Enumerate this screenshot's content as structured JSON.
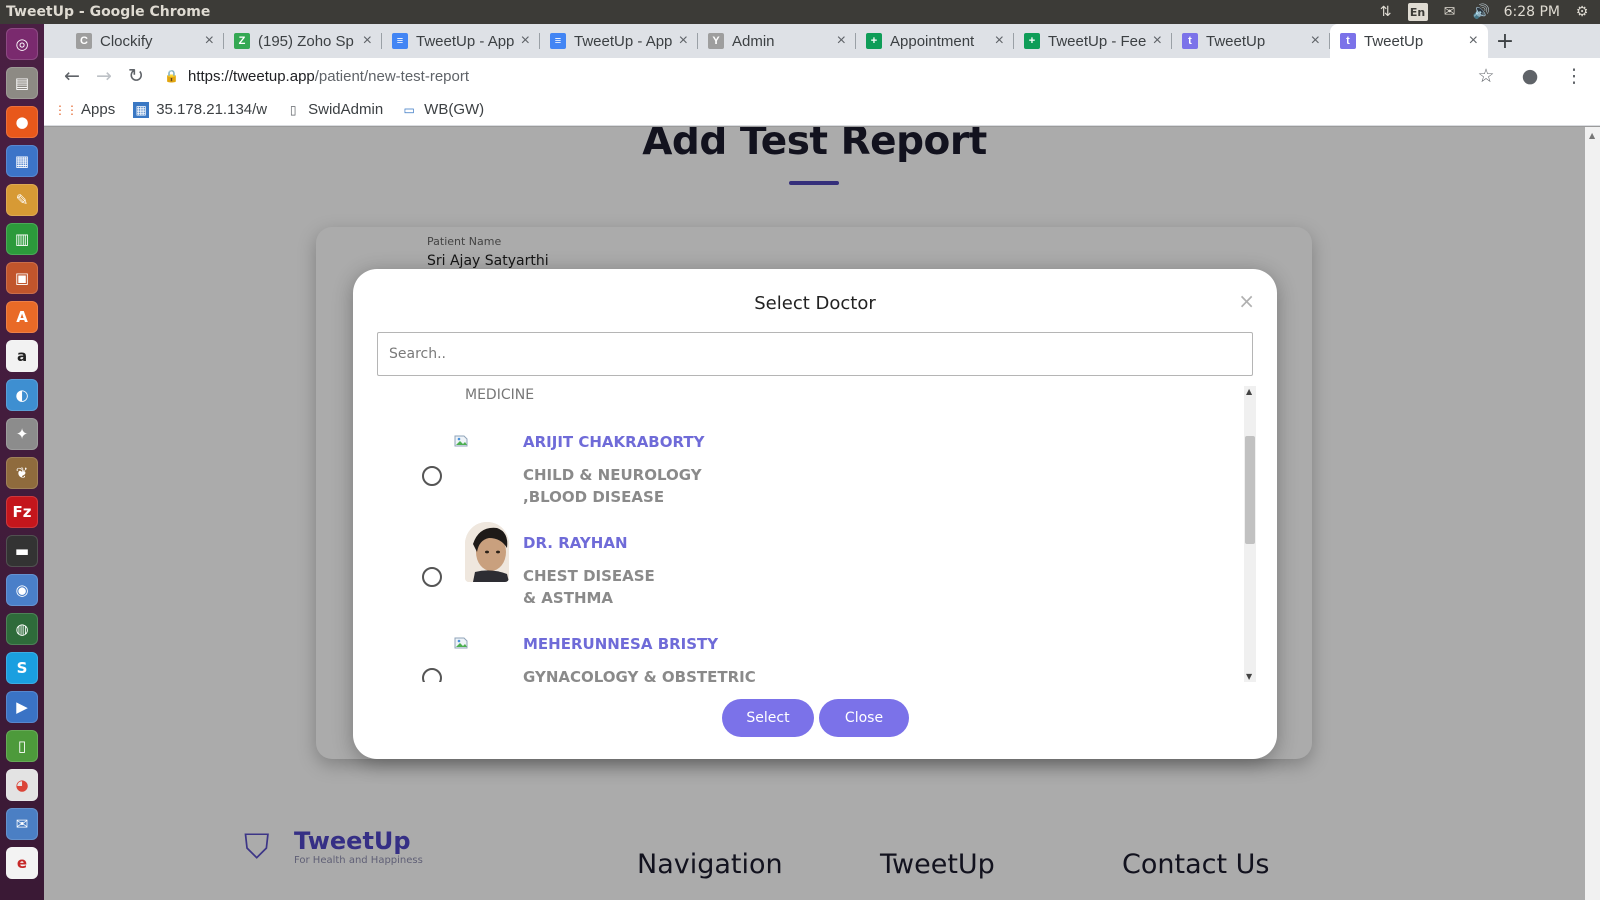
{
  "os": {
    "window_title": "TweetUp - Google Chrome",
    "tray": {
      "language": "En",
      "time": "6:28 PM"
    }
  },
  "browser": {
    "tabs": [
      {
        "label": "Clockify",
        "icon": "clockify-icon",
        "color": "#9e9e9e"
      },
      {
        "label": "(195) Zoho Sp",
        "icon": "zoho-icon",
        "color": "#34a853"
      },
      {
        "label": "TweetUp - App",
        "icon": "docs-icon",
        "color": "#4285f4"
      },
      {
        "label": "TweetUp - App",
        "icon": "docs-icon",
        "color": "#4285f4"
      },
      {
        "label": "Admin",
        "icon": "admin-icon",
        "color": "#9e9e9e"
      },
      {
        "label": "Appointment",
        "icon": "sheets-icon",
        "color": "#0f9d58"
      },
      {
        "label": "TweetUp - Fee",
        "icon": "sheets-icon",
        "color": "#0f9d58"
      },
      {
        "label": "TweetUp",
        "icon": "tweetup-icon",
        "color": "#7b72e9"
      },
      {
        "label": "TweetUp",
        "icon": "tweetup-icon",
        "color": "#7b72e9"
      }
    ],
    "url_host": "https://tweetup.app",
    "url_path": "/patient/new-test-report",
    "bookmarks": [
      {
        "label": "Apps"
      },
      {
        "label": "35.178.21.134/w"
      },
      {
        "label": "SwidAdmin"
      },
      {
        "label": "WB(GW)"
      }
    ]
  },
  "page": {
    "heading": "Add Test Report",
    "patient_name_label": "Patient Name",
    "patient_name": "Sri Ajay Satyarthi",
    "footer": {
      "brand": "TweetUp",
      "tagline": "For Health and Happiness",
      "col1": "Navigation",
      "col2": "TweetUp",
      "col3": "Contact Us"
    }
  },
  "modal": {
    "title": "Select Doctor",
    "close_glyph": "×",
    "search_placeholder": "Search..",
    "specialty_heading": "MEDICINE",
    "doctors": [
      {
        "name": "ARIJIT CHAKRABORTY",
        "specialty": "CHILD & NEUROLOGY ,BLOOD DISEASE",
        "photo": "broken-image"
      },
      {
        "name": "DR. RAYHAN",
        "specialty": "CHEST DISEASE & ASTHMA",
        "photo": "portrait"
      },
      {
        "name": "MEHERUNNESA BRISTY",
        "specialty": "GYNACOLOGY & OBSTETRIC",
        "photo": "broken-image"
      }
    ],
    "select_label": "Select",
    "close_label": "Close",
    "accent_color": "#7b72e9"
  }
}
